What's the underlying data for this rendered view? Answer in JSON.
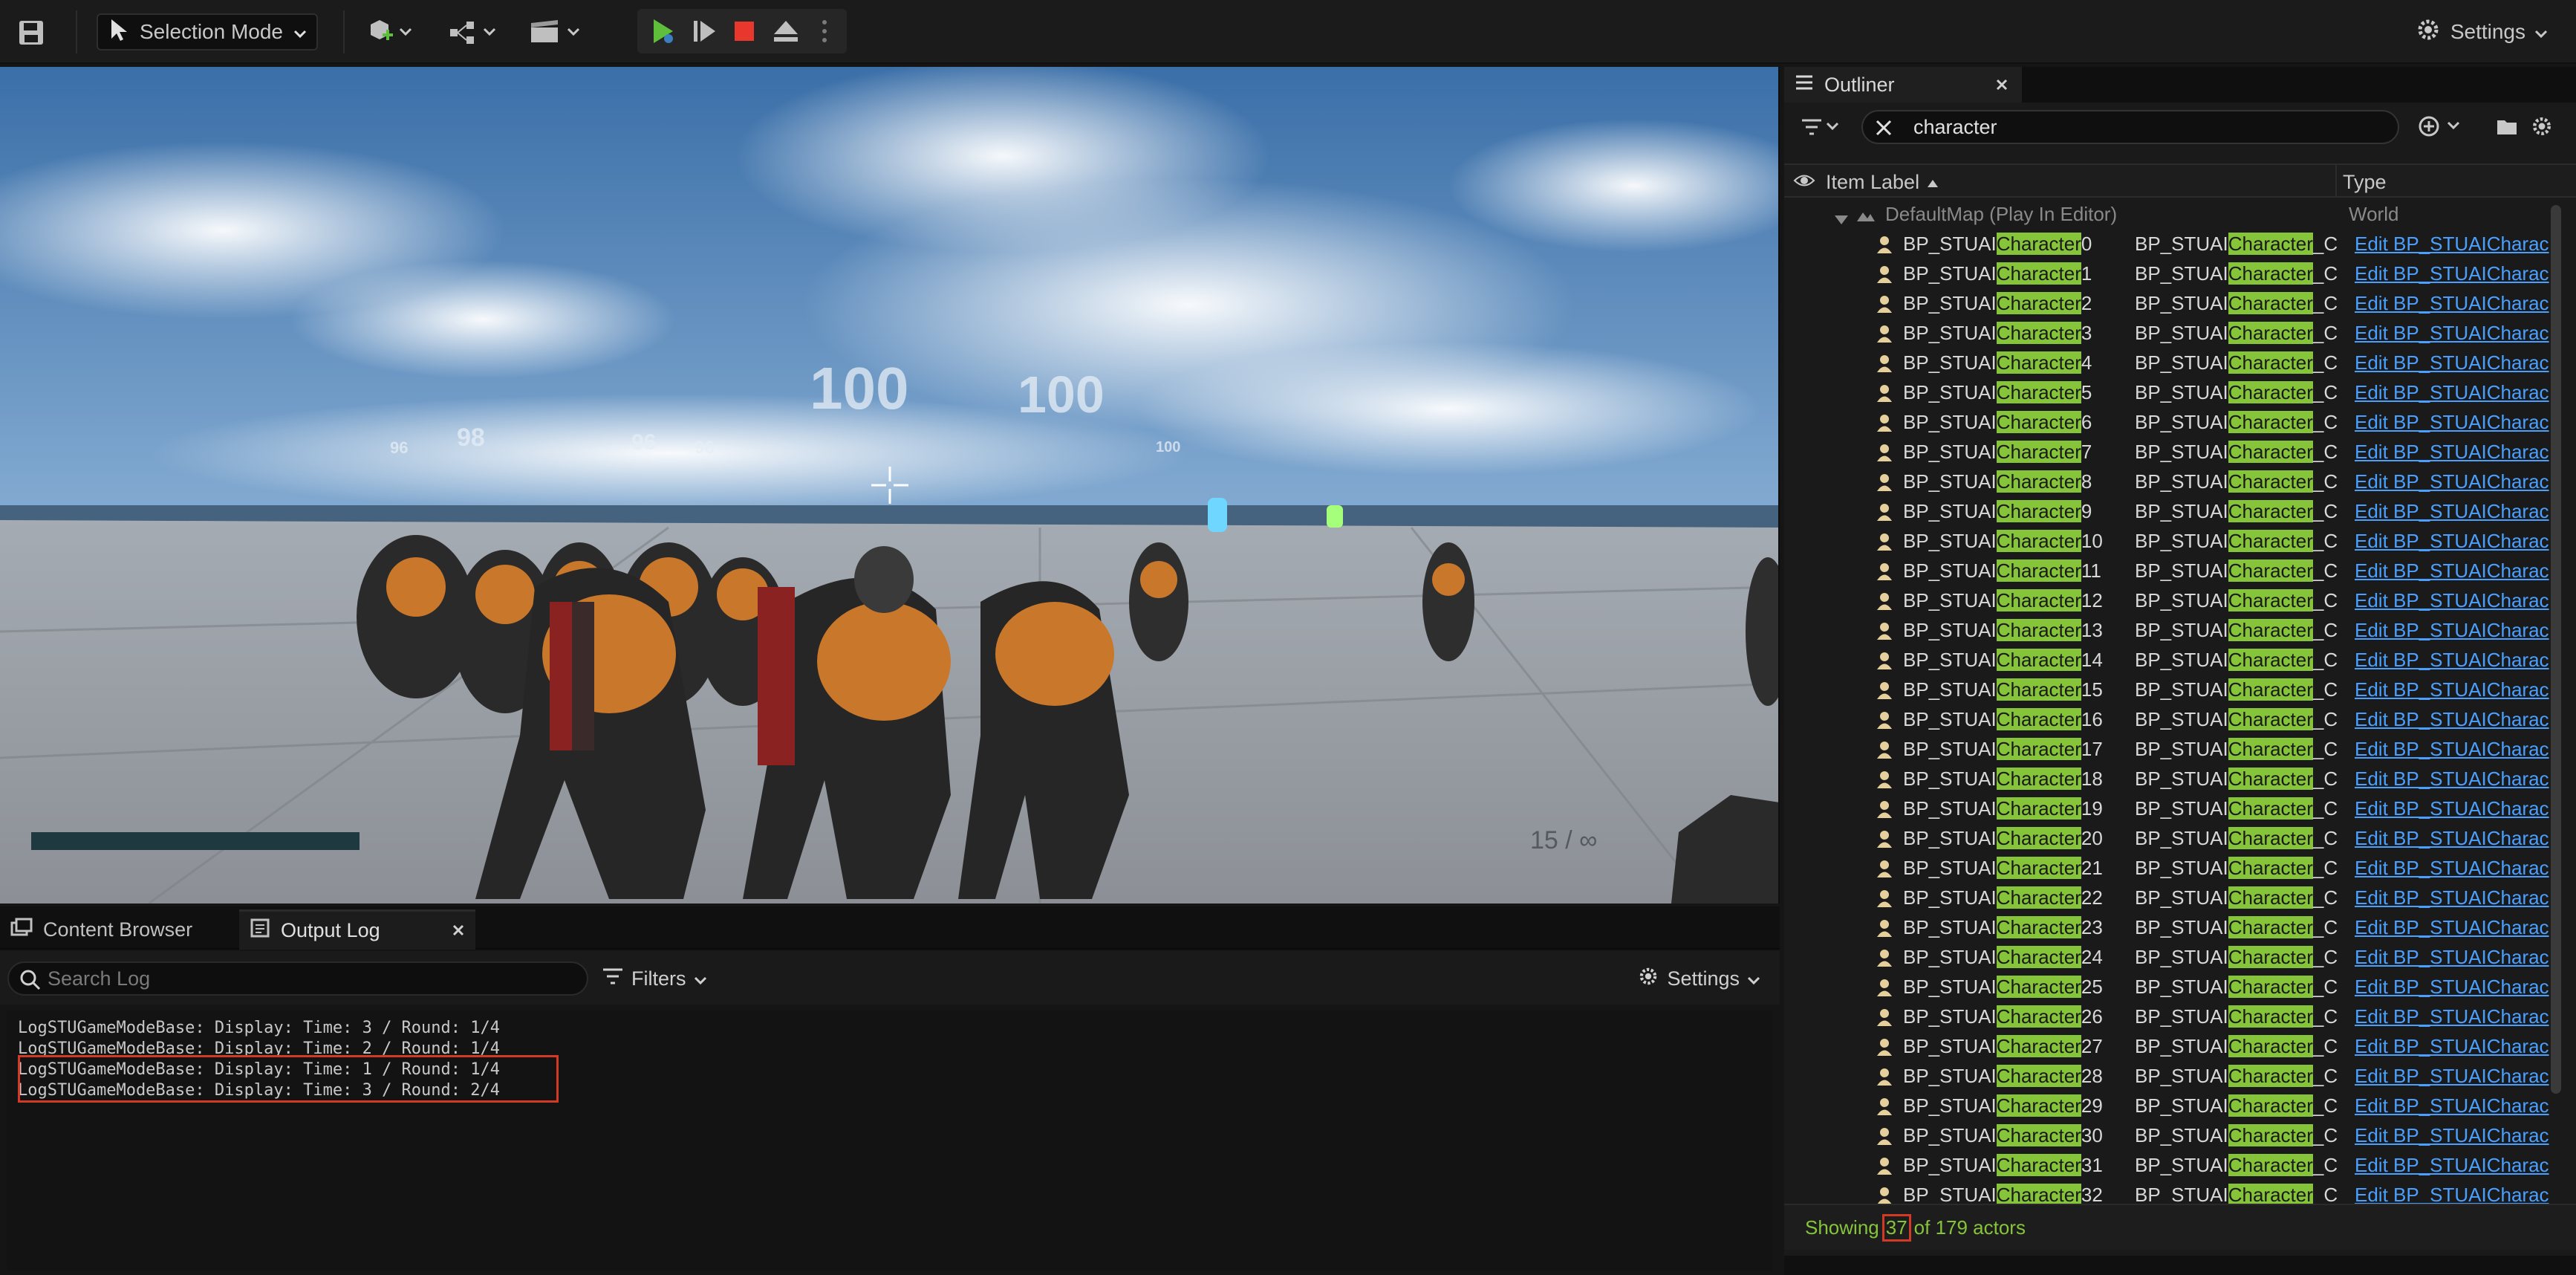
{
  "toolbar": {
    "mode_label": "Selection Mode",
    "settings_label": "Settings"
  },
  "viewport": {
    "damage_numbers": [
      "100",
      "100",
      "98",
      "96",
      "96",
      "96",
      "100"
    ],
    "ammo_text": "15 / ∞",
    "health_bar_color": "#1e3a40"
  },
  "bottom": {
    "tabs": [
      "Content Browser",
      "Output Log"
    ],
    "search_placeholder": "Search Log",
    "filters_label": "Filters",
    "settings_label": "Settings",
    "log_lines": [
      "LogSTUGameModeBase: Display: Time: 3 / Round: 1/4",
      "LogSTUGameModeBase: Display: Time: 2 / Round: 1/4",
      "LogSTUGameModeBase: Display: Time: 1 / Round: 1/4",
      "LogSTUGameModeBase: Display: Time: 3 / Round: 2/4"
    ]
  },
  "outliner": {
    "tab_title": "Outliner",
    "search_value": "character",
    "col_item_label": "Item Label",
    "col_type": "Type",
    "root_label": "DefaultMap (Play In Editor)",
    "root_type": "World",
    "name_prefix": "BP_STUAI",
    "highlight_word": "Character",
    "type_prefix": "BP_STUAI",
    "type_suffix": "_C",
    "edit_link": "Edit BP_STUAICharac",
    "actor_indices": [
      "0",
      "1",
      "2",
      "3",
      "4",
      "5",
      "6",
      "7",
      "8",
      "9",
      "10",
      "11",
      "12",
      "13",
      "14",
      "15",
      "16",
      "17",
      "18",
      "19",
      "20",
      "21",
      "22",
      "23",
      "24",
      "25",
      "26",
      "27",
      "28",
      "29",
      "30",
      "31",
      "32"
    ],
    "status_showing": "Showing",
    "status_count": "37",
    "status_rest": "of 179 actors"
  },
  "colors": {
    "highlight_green": "#86c43a",
    "link_blue": "#4aa0ff",
    "annotation_red": "#d23a26"
  }
}
